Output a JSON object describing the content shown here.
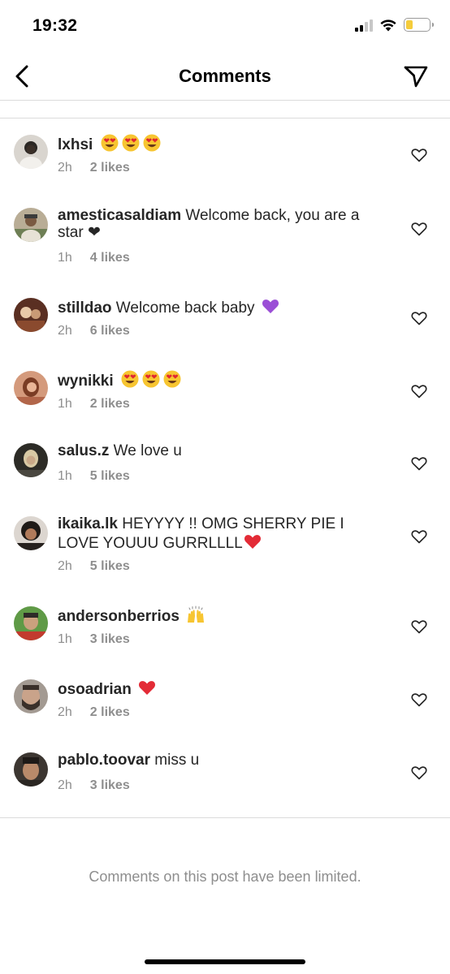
{
  "status_bar": {
    "time": "19:32",
    "battery_color": "#f5cc3b"
  },
  "nav": {
    "title": "Comments",
    "back_icon": "chevron-left-icon",
    "action_icon": "send-icon"
  },
  "comments": [
    {
      "username": "lxhsi",
      "text": "",
      "emoji": [
        "heart-eyes",
        "heart-eyes",
        "heart-eyes"
      ],
      "time": "2h",
      "likes": "2 likes",
      "avatar_color": "#b8b1a6"
    },
    {
      "username": "amesticasaldiam",
      "text": "Welcome back, you are a star ❤",
      "emoji": [],
      "time": "1h",
      "likes": "4 likes",
      "avatar_color": "#8a7a64"
    },
    {
      "username": "stilldao",
      "text": "Welcome back baby",
      "emoji": [
        "purple-heart"
      ],
      "time": "2h",
      "likes": "6 likes",
      "avatar_color": "#6b3d2c"
    },
    {
      "username": "wynikki",
      "text": "",
      "emoji": [
        "heart-eyes",
        "heart-eyes",
        "heart-eyes"
      ],
      "time": "1h",
      "likes": "2 likes",
      "avatar_color": "#c07a58"
    },
    {
      "username": "salus.z",
      "text": "We love u",
      "emoji": [],
      "time": "1h",
      "likes": "5 likes",
      "avatar_color": "#3b3a33"
    },
    {
      "username": "ikaika.lk",
      "text": "HEYYYY !! OMG SHERRY PIE I LOVE YOUUU GURRLLLL",
      "emoji": [
        "red-heart"
      ],
      "time": "2h",
      "likes": "5 likes",
      "avatar_color": "#2a2522"
    },
    {
      "username": "andersonberrios",
      "text": "",
      "emoji": [
        "raising-hands"
      ],
      "time": "1h",
      "likes": "3 likes",
      "avatar_color": "#4f7a3a"
    },
    {
      "username": "osoadrian",
      "text": "",
      "emoji": [
        "red-heart"
      ],
      "time": "2h",
      "likes": "2 likes",
      "avatar_color": "#7a6a5f"
    },
    {
      "username": "pablo.toovar",
      "text": "miss u",
      "emoji": [],
      "time": "2h",
      "likes": "3 likes",
      "avatar_color": "#5a4a3a"
    }
  ],
  "footer": {
    "note": "Comments on this post have been limited."
  }
}
